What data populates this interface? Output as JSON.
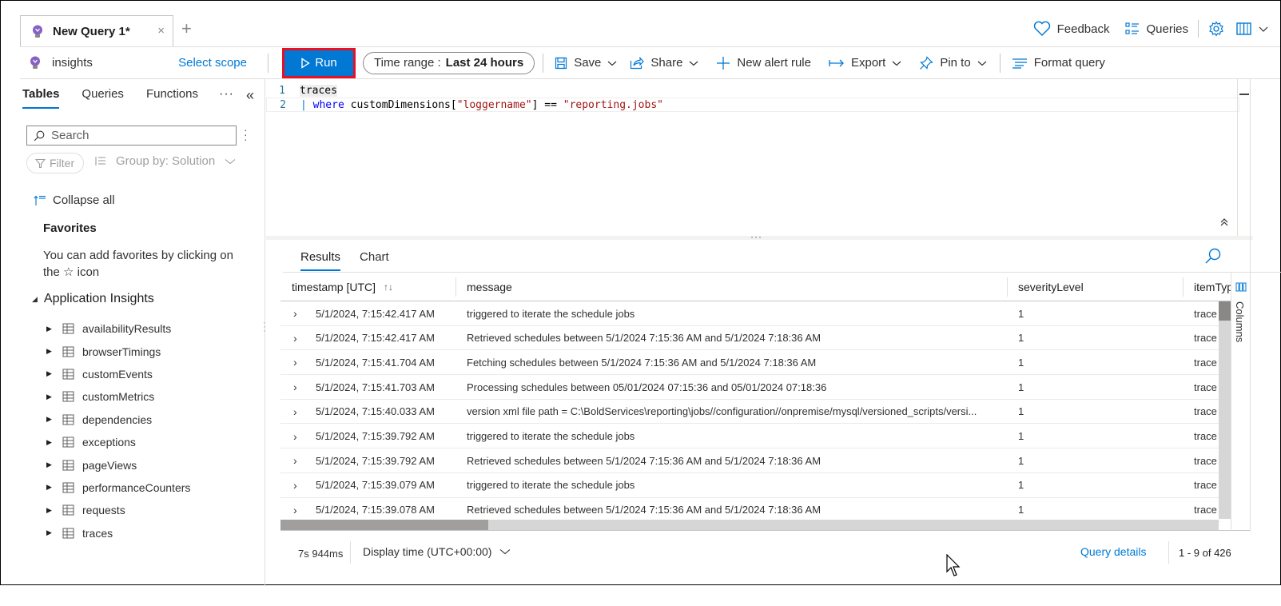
{
  "tabs": {
    "active_title": "New Query 1*",
    "close_glyph": "×",
    "add_glyph": "+"
  },
  "header_right": {
    "feedback_label": "Feedback",
    "queries_label": "Queries"
  },
  "toolbar": {
    "scope_name": "insights",
    "select_scope_label": "Select scope",
    "run_label": "Run",
    "time_range_label": "Time range :",
    "time_range_value": "Last 24 hours",
    "save_label": "Save",
    "share_label": "Share",
    "new_alert_label": "New alert rule",
    "export_label": "Export",
    "pin_label": "Pin to",
    "format_label": "Format query"
  },
  "sidebar": {
    "tabs": [
      {
        "label": "Tables",
        "active": true
      },
      {
        "label": "Queries",
        "active": false
      },
      {
        "label": "Functions",
        "active": false
      }
    ],
    "more_glyph": "···",
    "collapse_glyph": "«",
    "search_placeholder": "Search",
    "filter_label": "Filter",
    "group_by_label": "Group by: Solution",
    "collapse_all_label": "Collapse all",
    "favorites_title": "Favorites",
    "favorites_text": "You can add favorites by clicking on the ☆ icon",
    "section_title": "Application Insights",
    "tables": [
      "availabilityResults",
      "browserTimings",
      "customEvents",
      "customMetrics",
      "dependencies",
      "exceptions",
      "pageViews",
      "performanceCounters",
      "requests",
      "traces"
    ]
  },
  "editor": {
    "lines": [
      {
        "number": "1",
        "text": "traces"
      },
      {
        "number": "2",
        "pipe": "|",
        "keyword": "where",
        "ident": "customDimensions[",
        "key": "\"loggername\"",
        "op": "] ==",
        "value": "\"reporting.jobs\""
      }
    ]
  },
  "results": {
    "tabs": [
      {
        "label": "Results",
        "active": true
      },
      {
        "label": "Chart",
        "active": false
      }
    ],
    "columns": [
      "timestamp [UTC]",
      "message",
      "severityLevel",
      "itemTyp"
    ],
    "sort_glyph": "↑↓",
    "columns_panel_label": "Columns",
    "rows": [
      {
        "timestamp": "5/1/2024, 7:15:42.417 AM",
        "message": "triggered to iterate the schedule jobs",
        "severityLevel": "1",
        "itemType": "trace"
      },
      {
        "timestamp": "5/1/2024, 7:15:42.417 AM",
        "message": "Retrieved schedules between 5/1/2024 7:15:36 AM and 5/1/2024 7:18:36 AM",
        "severityLevel": "1",
        "itemType": "trace"
      },
      {
        "timestamp": "5/1/2024, 7:15:41.704 AM",
        "message": "Fetching schedules between 5/1/2024 7:15:36 AM and 5/1/2024 7:18:36 AM",
        "severityLevel": "1",
        "itemType": "trace"
      },
      {
        "timestamp": "5/1/2024, 7:15:41.703 AM",
        "message": "Processing schedules between 05/01/2024 07:15:36 and 05/01/2024 07:18:36",
        "severityLevel": "1",
        "itemType": "trace"
      },
      {
        "timestamp": "5/1/2024, 7:15:40.033 AM",
        "message": "version xml file path = C:\\BoldServices\\reporting\\jobs//configuration//onpremise/mysql/versioned_scripts/versi...",
        "severityLevel": "1",
        "itemType": "trace"
      },
      {
        "timestamp": "5/1/2024, 7:15:39.792 AM",
        "message": "triggered to iterate the schedule jobs",
        "severityLevel": "1",
        "itemType": "trace"
      },
      {
        "timestamp": "5/1/2024, 7:15:39.792 AM",
        "message": "Retrieved schedules between 5/1/2024 7:15:36 AM and 5/1/2024 7:18:36 AM",
        "severityLevel": "1",
        "itemType": "trace"
      },
      {
        "timestamp": "5/1/2024, 7:15:39.079 AM",
        "message": "triggered to iterate the schedule jobs",
        "severityLevel": "1",
        "itemType": "trace"
      },
      {
        "timestamp": "5/1/2024, 7:15:39.078 AM",
        "message": "Retrieved schedules between 5/1/2024 7:15:36 AM and 5/1/2024 7:18:36 AM",
        "severityLevel": "1",
        "itemType": "trace"
      }
    ]
  },
  "footer": {
    "elapsed": "7s 944ms",
    "display_time_label": "Display time (UTC+00:00)",
    "query_details_label": "Query details",
    "record_range": "1 - 9 of 426"
  },
  "colors": {
    "accent": "#0078d4",
    "run_outline": "#e81123",
    "kql_keyword": "#0000ff",
    "kql_string": "#a31515"
  }
}
